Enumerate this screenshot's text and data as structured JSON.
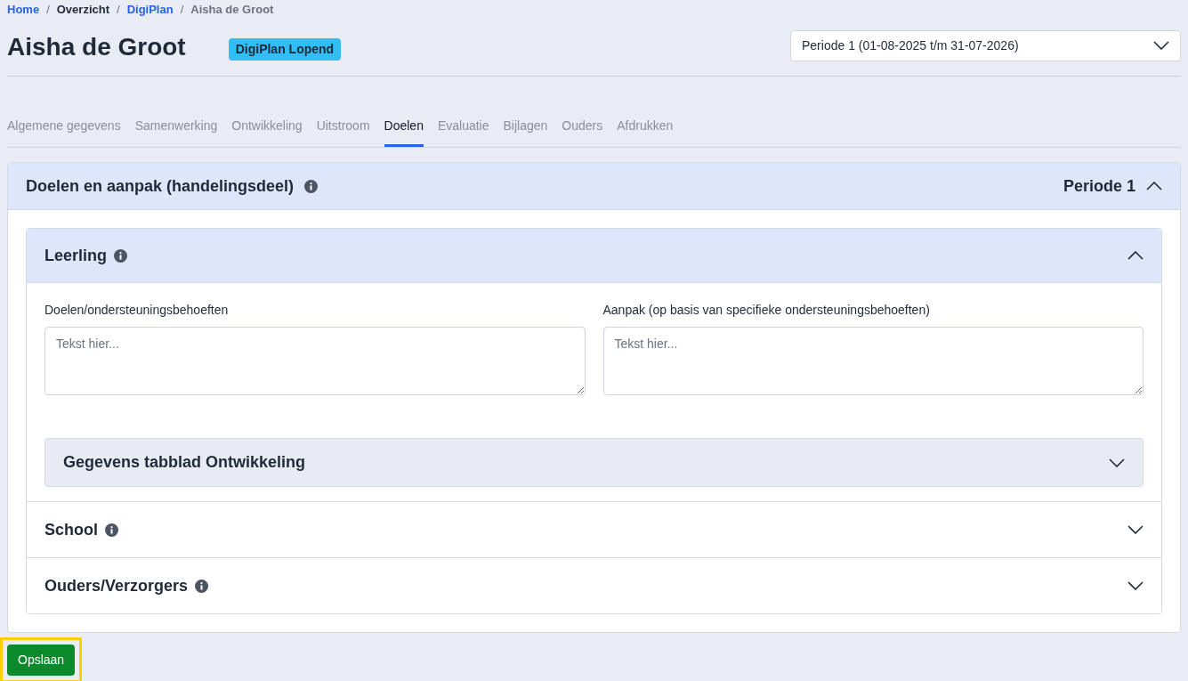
{
  "breadcrumb": [
    {
      "label": "Home",
      "kind": "link"
    },
    {
      "label": "Overzicht",
      "kind": "plain"
    },
    {
      "label": "DigiPlan",
      "kind": "link"
    },
    {
      "label": "Aisha de Groot",
      "kind": "current"
    }
  ],
  "breadcrumb_separator": "/",
  "title": "Aisha de Groot",
  "badge": "DigiPlan Lopend",
  "period_select": {
    "value": "Periode 1 (01-08-2025 t/m 31-07-2026)"
  },
  "tabs": [
    {
      "label": "Algemene gegevens",
      "selected": false
    },
    {
      "label": "Samenwerking",
      "selected": false
    },
    {
      "label": "Ontwikkeling",
      "selected": false
    },
    {
      "label": "Uitstroom",
      "selected": false
    },
    {
      "label": "Doelen",
      "selected": true
    },
    {
      "label": "Evaluatie",
      "selected": false
    },
    {
      "label": "Bijlagen",
      "selected": false
    },
    {
      "label": "Ouders",
      "selected": false
    },
    {
      "label": "Afdrukken",
      "selected": false
    }
  ],
  "card": {
    "title": "Doelen en aanpak (handelingsdeel)",
    "period_label": "Periode 1",
    "expanded": true,
    "sections": [
      {
        "title": "Leerling",
        "expanded": true,
        "fields": [
          {
            "label": "Doelen/ondersteuningsbehoeften",
            "placeholder": "Tekst hier..."
          },
          {
            "label": "Aanpak (op basis van specifieke ondersteuningsbehoeften)",
            "placeholder": "Tekst hier..."
          }
        ],
        "subsections": [
          {
            "title": "Gegevens tabblad Ontwikkeling",
            "expanded": false
          }
        ]
      },
      {
        "title": "School",
        "expanded": false
      },
      {
        "title": "Ouders/Verzorgers",
        "expanded": false
      }
    ]
  },
  "save_button": {
    "label": "Opslaan",
    "highlighted": true
  }
}
